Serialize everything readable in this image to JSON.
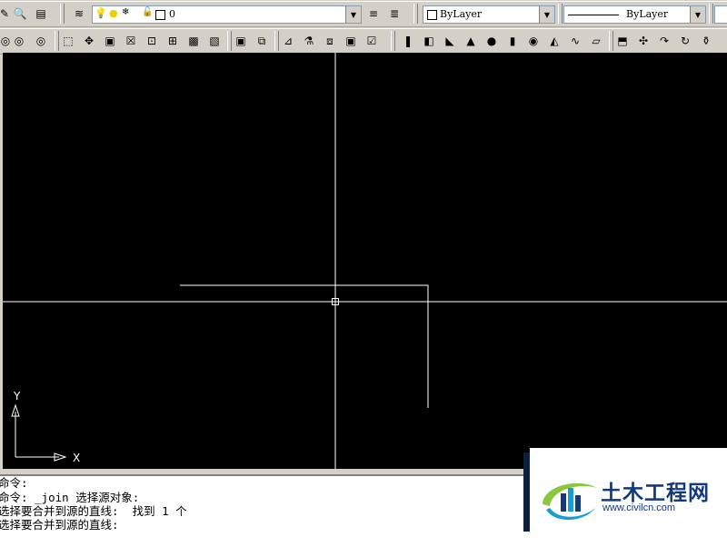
{
  "toolbar_top": {
    "layer_combo_value": "0",
    "color_combo_value": "ByLayer",
    "linetype_combo_value": "ByLayer",
    "buttons": [
      "pencil-icon",
      "zoom-icon",
      "layer-manager-icon",
      "layers-icon",
      "bulb-icon",
      "sun-icon",
      "lock-icon",
      "layer-states-icon",
      "make-current-icon"
    ]
  },
  "toolbar_3d": {
    "buttons": [
      "orbit-icon",
      "continuous-orbit-icon",
      "box-icon",
      "wedge-icon",
      "cylinder-icon",
      "cone-icon",
      "sphere-icon",
      "torus-icon",
      "pyramid-icon",
      "planar-surface-icon",
      "extrude-icon",
      "revolve-icon",
      "sweep-icon",
      "loft-icon",
      "union-icon",
      "subtract-icon",
      "intersect-icon",
      "slice-icon",
      "section-icon",
      "interfere-icon"
    ]
  },
  "canvas": {
    "background": "#000000",
    "ucs_y_label": "Y",
    "ucs_x_label": "X"
  },
  "command": {
    "lines": [
      "命令:",
      "命令: _join 选择源对象:",
      "选择要合并到源的直线:  找到 1 个",
      "选择要合并到源的直线:"
    ]
  },
  "watermark": {
    "title": "土木工程网",
    "url": "www.civilcn.com"
  }
}
